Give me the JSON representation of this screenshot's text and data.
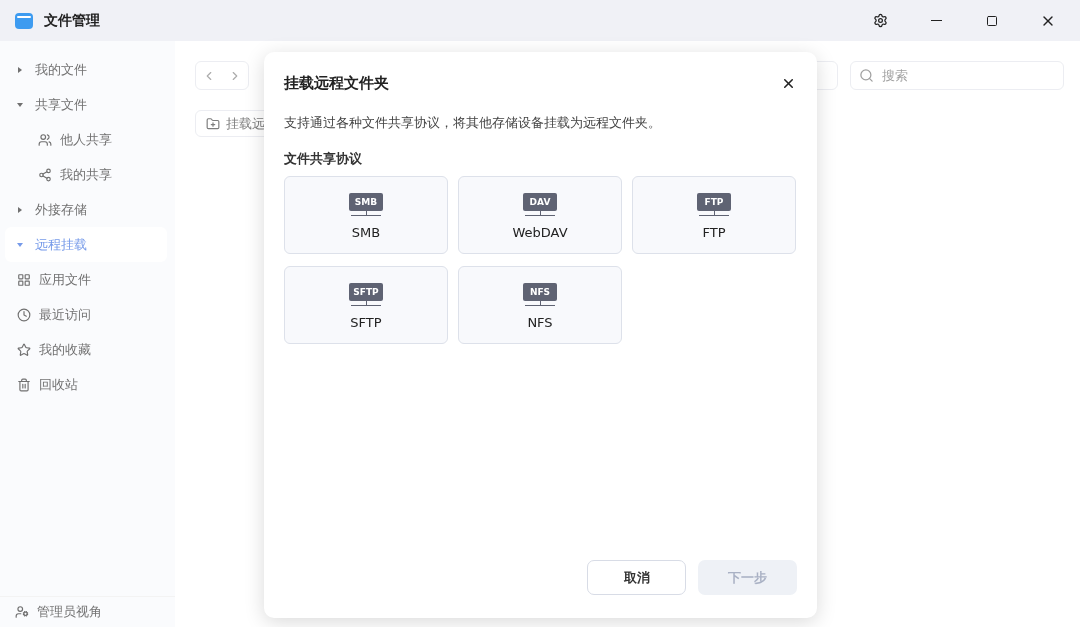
{
  "window": {
    "title": "文件管理"
  },
  "sidebar": {
    "items": [
      {
        "label": "我的文件",
        "kind": "caret",
        "expanded": false,
        "selected": false
      },
      {
        "label": "共享文件",
        "kind": "caret",
        "expanded": true,
        "selected": false,
        "children": [
          {
            "label": "他人共享",
            "kind": "users"
          },
          {
            "label": "我的共享",
            "kind": "share"
          }
        ]
      },
      {
        "label": "外接存储",
        "kind": "caret",
        "expanded": false,
        "selected": false
      },
      {
        "label": "远程挂载",
        "kind": "caret",
        "expanded": true,
        "selected": true
      },
      {
        "label": "应用文件",
        "kind": "apps",
        "selected": false
      },
      {
        "label": "最近访问",
        "kind": "clock",
        "selected": false
      },
      {
        "label": "我的收藏",
        "kind": "star",
        "selected": false
      },
      {
        "label": "回收站",
        "kind": "trash",
        "selected": false
      }
    ],
    "footer": "管理员视角"
  },
  "toolbar": {
    "mount_button": "挂载远",
    "search": {
      "placeholder": "搜索"
    }
  },
  "dialog": {
    "title": "挂载远程文件夹",
    "description": "支持通过各种文件共享协议，将其他存储设备挂载为远程文件夹。",
    "section": "文件共享协议",
    "protocols": [
      {
        "badge": "SMB",
        "label": "SMB"
      },
      {
        "badge": "DAV",
        "label": "WebDAV"
      },
      {
        "badge": "FTP",
        "label": "FTP"
      },
      {
        "badge": "SFTP",
        "label": "SFTP"
      },
      {
        "badge": "NFS",
        "label": "NFS"
      }
    ],
    "buttons": [
      {
        "label": "取消",
        "kind": "secondary",
        "disabled": false
      },
      {
        "label": "下一步",
        "kind": "primary",
        "disabled": true
      }
    ]
  }
}
